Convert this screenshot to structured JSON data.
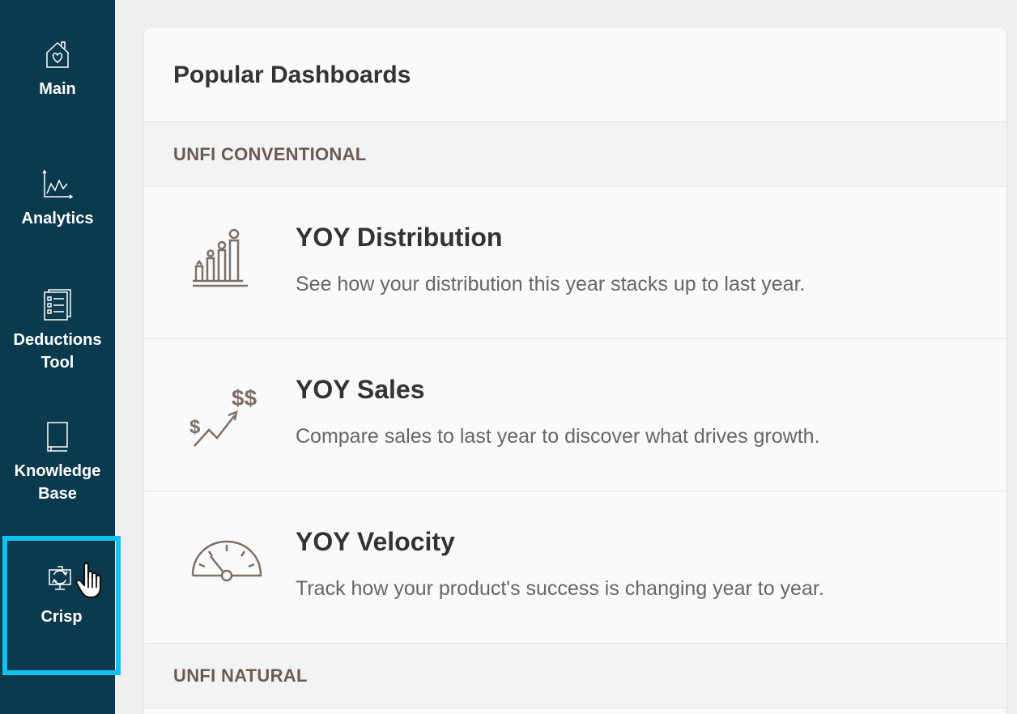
{
  "sidebar": {
    "items": [
      {
        "label": "Main",
        "icon": "home-heart-icon"
      },
      {
        "label": "Analytics",
        "icon": "line-chart-icon"
      },
      {
        "label": "Deductions\nTool",
        "icon": "document-list-icon"
      },
      {
        "label": "Knowledge\nBase",
        "icon": "book-icon"
      },
      {
        "label": "Crisp",
        "icon": "monitor-refresh-icon"
      }
    ],
    "background": "#0b3a4f",
    "highlight_color": "#0ec2f0"
  },
  "main": {
    "title": "Popular Dashboards",
    "sections": [
      {
        "label": "UNFI CONVENTIONAL",
        "dashboards": [
          {
            "title": "YOY Distribution",
            "description": "See how your distribution this year stacks up to last year.",
            "icon": "bar-chart-people-icon"
          },
          {
            "title": "YOY Sales",
            "description": "Compare sales to last year to discover what drives growth.",
            "icon": "sales-growth-icon"
          },
          {
            "title": "YOY Velocity",
            "description": "Track how your product's success is changing year to year.",
            "icon": "speedometer-icon"
          }
        ]
      },
      {
        "label": "UNFI NATURAL",
        "dashboards": []
      }
    ]
  }
}
